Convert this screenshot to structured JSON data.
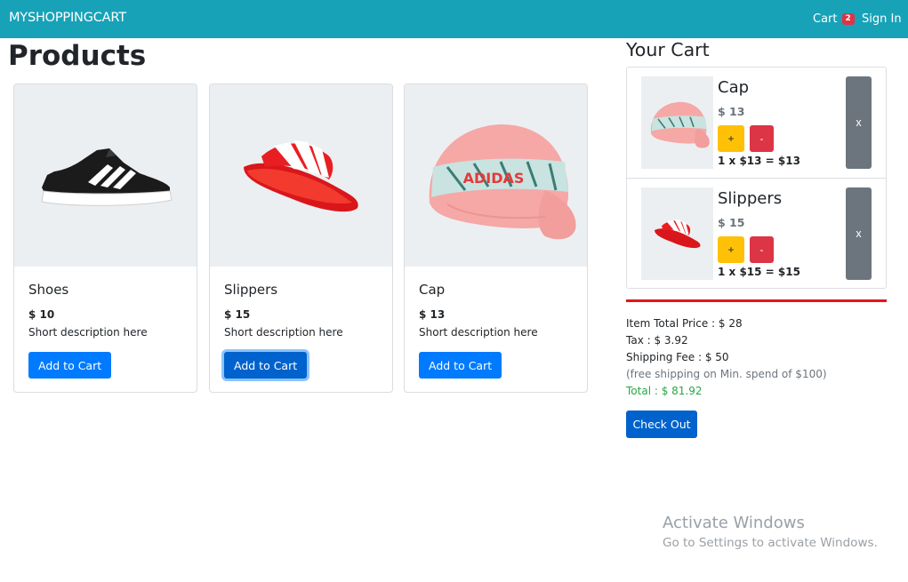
{
  "navbar": {
    "brand": "MYSHOPPINGCART",
    "cart_label": "Cart",
    "cart_count": "2",
    "signin_label": "Sign In",
    "color": "#17a2b8"
  },
  "products": {
    "title": "Products",
    "button_label": "Add to Cart",
    "items": [
      {
        "name": "Shoes",
        "price": "$ 10",
        "description": "Short description here",
        "image_icon": "sneaker-image"
      },
      {
        "name": "Slippers",
        "price": "$ 15",
        "description": "Short description here",
        "image_icon": "slipper-image"
      },
      {
        "name": "Cap",
        "price": "$ 13",
        "description": "Short description here",
        "image_icon": "cap-image"
      }
    ]
  },
  "cart": {
    "title": "Your Cart",
    "plus_label": "+",
    "minus_label": "-",
    "remove_label": "x",
    "items": [
      {
        "name": "Cap",
        "price": "$ 13",
        "calc": "1 x $13 = $13",
        "image_icon": "cap-image"
      },
      {
        "name": "Slippers",
        "price": "$ 15",
        "calc": "1 x $15 = $15",
        "image_icon": "slipper-image"
      }
    ]
  },
  "summary": {
    "item_total": "Item Total Price : $ 28",
    "tax": "Tax : $ 3.92",
    "shipping": "Shipping Fee : $ 50",
    "shipping_note": "(free shipping on Min. spend of $100)",
    "total": "Total : $ 81.92",
    "checkout_label": "Check Out"
  },
  "watermark": {
    "title": "Activate Windows",
    "subtitle": "Go to Settings to activate Windows."
  },
  "colors": {
    "primary": "#007bff",
    "warning": "#ffc107",
    "danger": "#dc3545",
    "secondary": "#6c757d",
    "success": "#28a745"
  }
}
